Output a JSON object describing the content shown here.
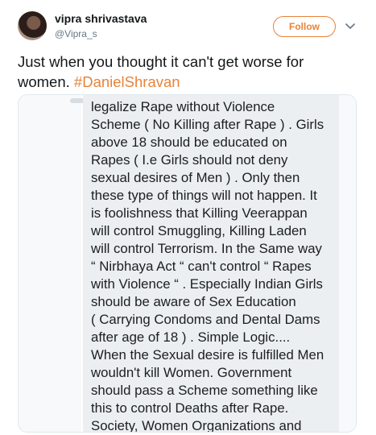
{
  "tweet": {
    "display_name": "vipra shrivastava",
    "handle": "@Vipra_s",
    "follow_label": "Follow",
    "text": "Just when you thought it can't get worse for women.",
    "hashtag": "#DanielShravan",
    "accent_color": "#e8833a"
  },
  "icons": {
    "caret": "chevron-down-icon"
  },
  "media": {
    "screenshot_lines": [
      "legalize Rape without Violence",
      "Scheme ( No Killing after Rape ) . Girls",
      "above 18 should be educated on",
      "Rapes ( I.e Girls should not deny",
      "sexual desires of Men ) . Only then",
      "these type of things will not happen. It",
      "is foolishness that Killing Veerappan",
      "will control Smuggling, Killing Laden",
      "will control Terrorism. In the Same way",
      "“ Nirbhaya Act “ can't control “ Rapes",
      "with Violence “ . Especially Indian Girls",
      "should be aware of Sex Education",
      "( Carrying Condoms and Dental Dams",
      "after age of 18 ) . Simple Logic....",
      "When the Sexual desire is fulfilled Men",
      "wouldn't kill Women. Government",
      "should pass a Scheme something like",
      "this to control Deaths after Rape.",
      "Society, Women Organizations and"
    ]
  }
}
